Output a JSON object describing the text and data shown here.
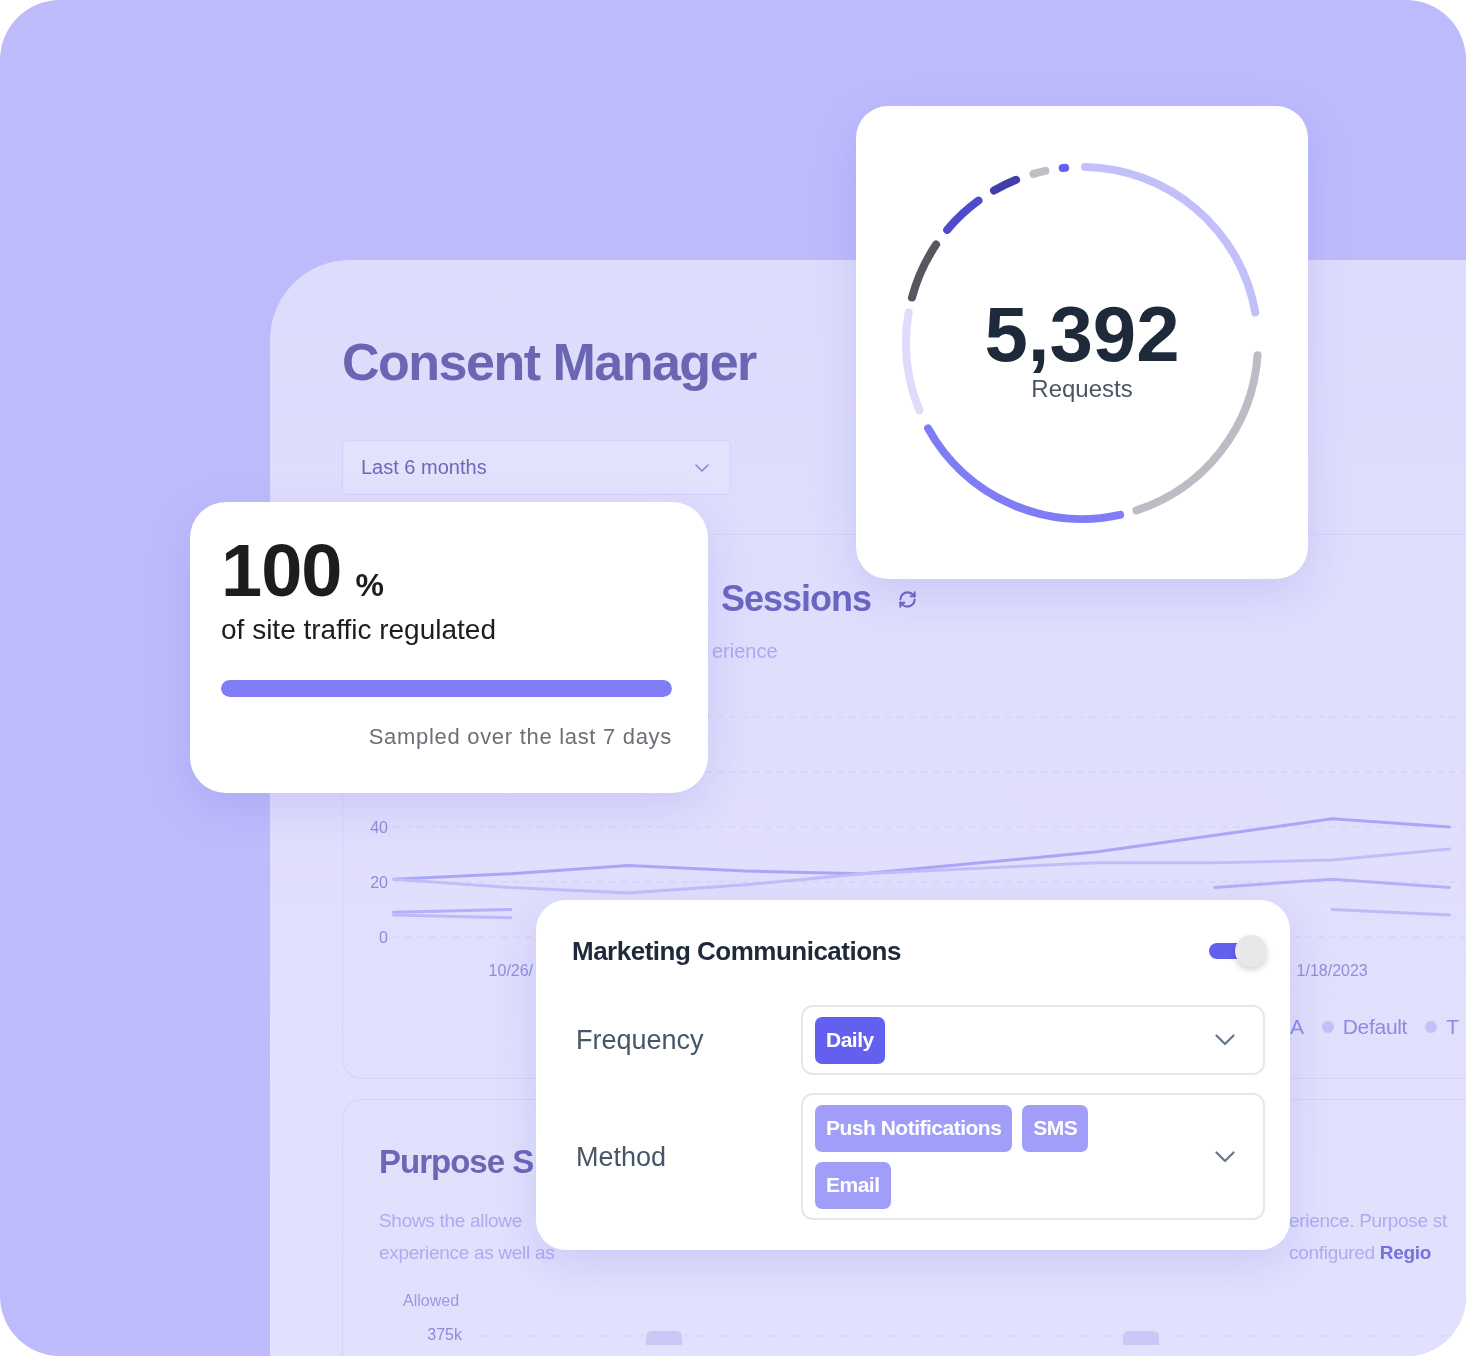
{
  "dashboard": {
    "title": "Consent Manager",
    "range_select": {
      "value": "Last 6 months"
    },
    "sessions": {
      "heading": "Sessions",
      "subtitle": "erience",
      "chart_data": {
        "type": "line",
        "categories": [
          null,
          "10/26/",
          null,
          null,
          null,
          null,
          null,
          null,
          "1/18/2023",
          null
        ],
        "ylim": [
          0,
          80
        ],
        "yticks": [
          0,
          20,
          40
        ],
        "series": [
          {
            "color": "#a9a6f8",
            "values": [
              21,
              23,
              26,
              24,
              23,
              27,
              31,
              37,
              43,
              40
            ]
          },
          {
            "color": "#c0bef9",
            "values": [
              21,
              18,
              16,
              19,
              23,
              25,
              27,
              27,
              28,
              32
            ]
          },
          {
            "color": "#b3b0f8",
            "values": [
              9,
              10,
              null,
              null,
              null,
              null,
              null,
              18,
              21,
              18
            ]
          },
          {
            "color": "#bdbaf8",
            "values": [
              8,
              7,
              null,
              null,
              null,
              null,
              null,
              null,
              10,
              8
            ]
          }
        ]
      },
      "legend": {
        "cut_label": "A",
        "items": [
          {
            "label": "Default"
          },
          {
            "label": "T"
          }
        ]
      }
    },
    "purpose": {
      "heading": "Purpose S",
      "text_left": [
        "Shows the allowe",
        "experience as well as"
      ],
      "text_right": [
        "erience. Purpose st",
        "configured **Regio**"
      ],
      "chart": {
        "label": "Allowed",
        "tick": "375k"
      }
    }
  },
  "traffic_card": {
    "value": "100",
    "unit": "%",
    "label": "of site traffic regulated",
    "level": 1,
    "note": "Sampled over the last 7 days"
  },
  "requests_card": {
    "value": "5,392",
    "label": "Requests"
  },
  "marketing_card": {
    "title": "Marketing Communications",
    "toggle": {
      "on": true
    },
    "fields": [
      {
        "label": "Frequency",
        "kind": "single",
        "chips": [
          "Daily"
        ]
      },
      {
        "label": "Method",
        "kind": "multi",
        "chips": [
          "Push Notifications",
          "SMS",
          "Email"
        ]
      }
    ]
  }
}
